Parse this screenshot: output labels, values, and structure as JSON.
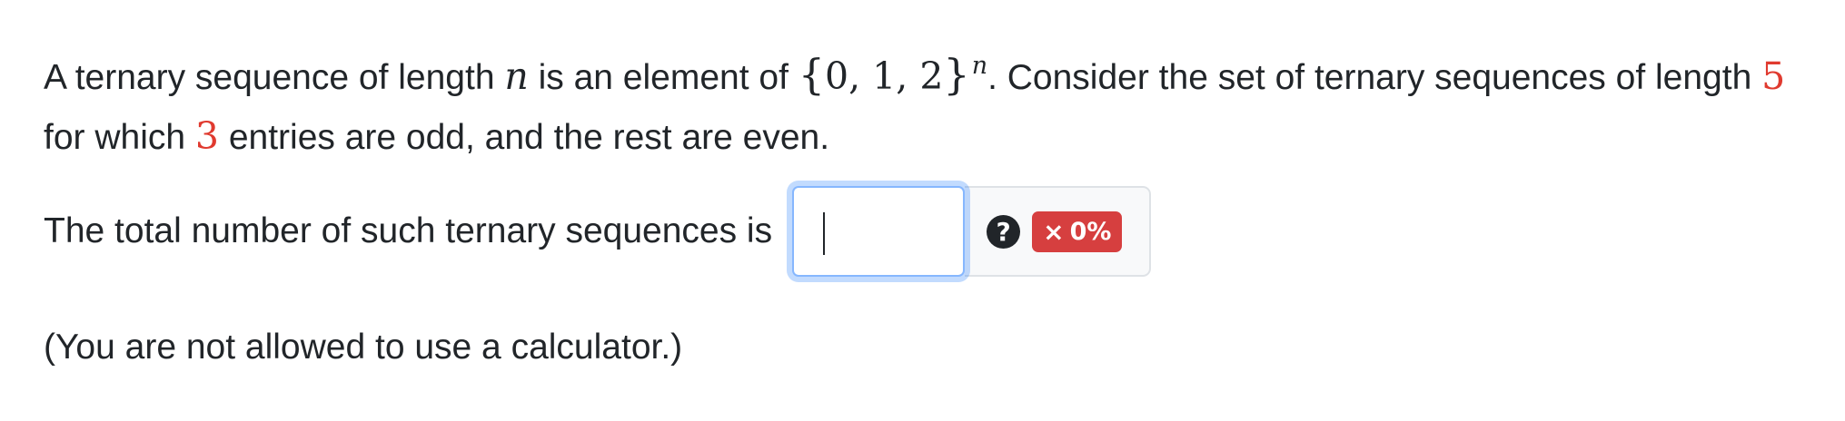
{
  "question": {
    "part1": "A ternary sequence of length ",
    "n": "n",
    "part2": " is an element of ",
    "set_open": "{",
    "set_elements": "0, 1, 2",
    "set_close": "}",
    "sup_n": "n",
    "part3": ". Consider the set of ternary sequences of length ",
    "length_value": "5",
    "part4": "for which ",
    "odd_count": "3",
    "part5": " entries are odd, and the rest are even."
  },
  "answer": {
    "prompt": "The total number of such ternary sequences is",
    "input_value": "",
    "help_icon_glyph": "?",
    "score_icon_glyph": "×",
    "score_label": "0%"
  },
  "note": "(You are not allowed to use a calculator.)",
  "colors": {
    "param_red": "#e03a2f",
    "score_badge": "#d63f3f",
    "focus_border": "#86b7fe"
  }
}
